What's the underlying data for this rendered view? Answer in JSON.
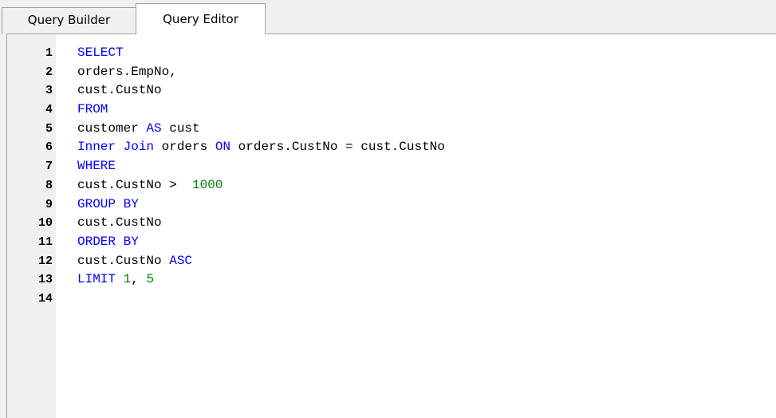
{
  "tabs": [
    {
      "label": "Query Builder",
      "active": false
    },
    {
      "label": "Query Editor",
      "active": true
    }
  ],
  "colors": {
    "keyword": "#0000ff",
    "number": "#008000",
    "identifier": "#000000",
    "gutter_background": "#f0f0f0",
    "editor_background": "#ffffff"
  },
  "editor": {
    "lines": [
      {
        "number": "1",
        "tokens": [
          {
            "text": "SELECT",
            "type": "kw"
          }
        ]
      },
      {
        "number": "2",
        "tokens": [
          {
            "text": "orders.EmpNo,",
            "type": "id"
          }
        ]
      },
      {
        "number": "3",
        "tokens": [
          {
            "text": "cust.CustNo",
            "type": "id"
          }
        ]
      },
      {
        "number": "4",
        "tokens": [
          {
            "text": "FROM",
            "type": "kw"
          }
        ]
      },
      {
        "number": "5",
        "tokens": [
          {
            "text": "customer ",
            "type": "id"
          },
          {
            "text": "AS",
            "type": "kw"
          },
          {
            "text": " cust",
            "type": "id"
          }
        ]
      },
      {
        "number": "6",
        "tokens": [
          {
            "text": "Inner Join",
            "type": "kw"
          },
          {
            "text": " orders ",
            "type": "id"
          },
          {
            "text": "ON",
            "type": "kw"
          },
          {
            "text": " orders.CustNo = cust.CustNo",
            "type": "id"
          }
        ]
      },
      {
        "number": "7",
        "tokens": [
          {
            "text": "WHERE",
            "type": "kw"
          }
        ]
      },
      {
        "number": "8",
        "tokens": [
          {
            "text": "cust.CustNo >  ",
            "type": "id"
          },
          {
            "text": "1000",
            "type": "num"
          }
        ]
      },
      {
        "number": "9",
        "tokens": [
          {
            "text": "GROUP BY",
            "type": "kw"
          }
        ]
      },
      {
        "number": "10",
        "tokens": [
          {
            "text": "cust.CustNo",
            "type": "id"
          }
        ]
      },
      {
        "number": "11",
        "tokens": [
          {
            "text": "ORDER BY",
            "type": "kw"
          }
        ]
      },
      {
        "number": "12",
        "tokens": [
          {
            "text": "cust.CustNo ",
            "type": "id"
          },
          {
            "text": "ASC",
            "type": "kw"
          }
        ]
      },
      {
        "number": "13",
        "tokens": [
          {
            "text": "LIMIT",
            "type": "kw"
          },
          {
            "text": " ",
            "type": "id"
          },
          {
            "text": "1",
            "type": "num"
          },
          {
            "text": ", ",
            "type": "id"
          },
          {
            "text": "5",
            "type": "num"
          }
        ]
      },
      {
        "number": "14",
        "tokens": []
      }
    ]
  }
}
